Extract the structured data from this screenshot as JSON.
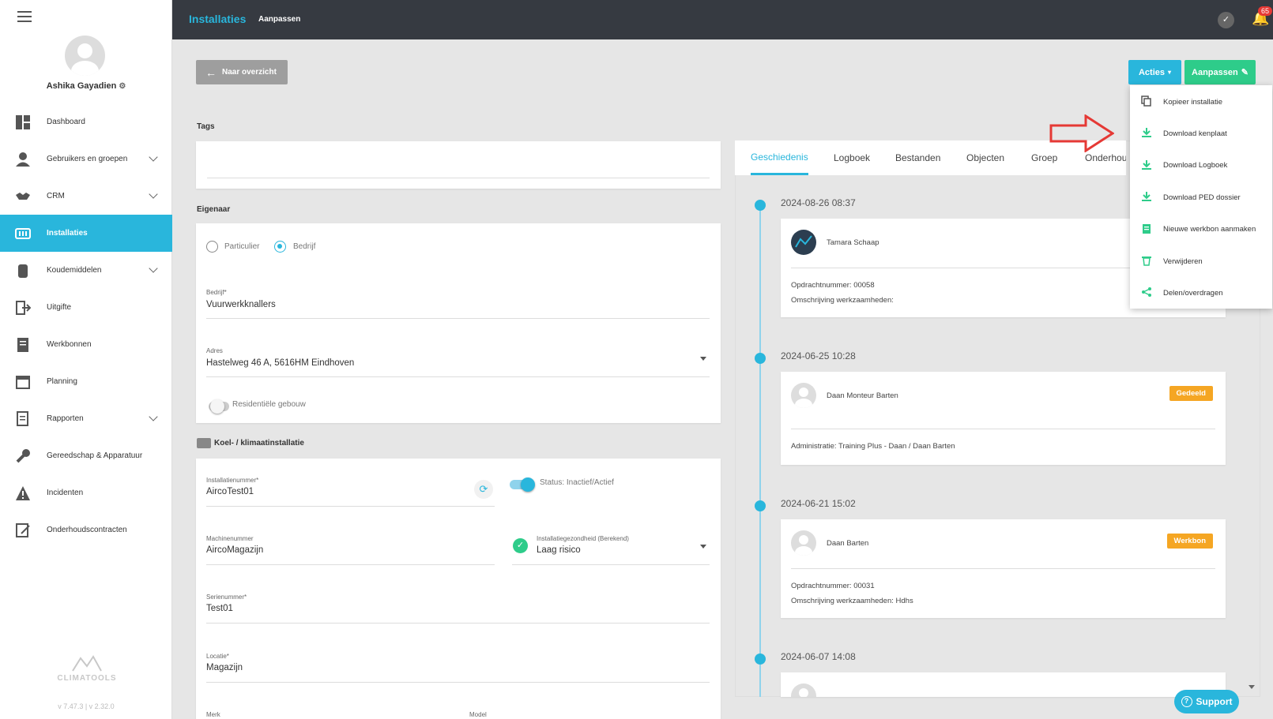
{
  "user": {
    "name": "Ashika Gayadien"
  },
  "version": "v 7.47.3 | v 2.32.0",
  "logo_text": "CLIMATOOLS",
  "sidebar": {
    "items": [
      {
        "label": "Dashboard",
        "icon": "dashboard-icon",
        "chevron": false,
        "active": false
      },
      {
        "label": "Gebruikers en groepen",
        "icon": "user-icon",
        "chevron": true,
        "active": false
      },
      {
        "label": "CRM",
        "icon": "handshake-icon",
        "chevron": true,
        "active": false
      },
      {
        "label": "Installaties",
        "icon": "installation-icon",
        "chevron": false,
        "active": true
      },
      {
        "label": "Koudemiddelen",
        "icon": "refrigerant-icon",
        "chevron": true,
        "active": false
      },
      {
        "label": "Uitgifte",
        "icon": "exit-icon",
        "chevron": false,
        "active": false
      },
      {
        "label": "Werkbonnen",
        "icon": "workorder-icon",
        "chevron": false,
        "active": false
      },
      {
        "label": "Planning",
        "icon": "calendar-icon",
        "chevron": false,
        "active": false
      },
      {
        "label": "Rapporten",
        "icon": "report-icon",
        "chevron": true,
        "active": false
      },
      {
        "label": "Gereedschap & Apparatuur",
        "icon": "wrench-icon",
        "chevron": false,
        "active": false
      },
      {
        "label": "Incidenten",
        "icon": "warning-icon",
        "chevron": false,
        "active": false
      },
      {
        "label": "Onderhoudscontracten",
        "icon": "contract-icon",
        "chevron": false,
        "active": false
      }
    ]
  },
  "header": {
    "title": "Installaties",
    "subtitle": "Aanpassen",
    "notification_count": "65"
  },
  "toolbar": {
    "back_label": "Naar overzicht",
    "acties_label": "Acties",
    "aanpassen_label": "Aanpassen"
  },
  "acties_menu": {
    "items": [
      {
        "label": "Kopieer installatie",
        "icon": "copy-icon"
      },
      {
        "label": "Download kenplaat",
        "icon": "download-icon"
      },
      {
        "label": "Download Logboek",
        "icon": "download-icon"
      },
      {
        "label": "Download PED dossier",
        "icon": "download-icon"
      },
      {
        "label": "Nieuwe werkbon aanmaken",
        "icon": "new-workorder-icon"
      },
      {
        "label": "Verwijderen",
        "icon": "trash-icon"
      },
      {
        "label": "Delen/overdragen",
        "icon": "share-icon"
      }
    ]
  },
  "form": {
    "tags_label": "Tags",
    "eigenaar_label": "Eigenaar",
    "owner_type": {
      "option1": "Particulier",
      "option2": "Bedrijf",
      "selected": "Bedrijf"
    },
    "bedrijf": {
      "label": "Bedrijf*",
      "value": "Vuurwerkknallers"
    },
    "adres": {
      "label": "Adres",
      "value": "Hastelweg 46 A, 5616HM Eindhoven"
    },
    "residentieel_label": "Residentiële gebouw",
    "koel_label": "Koel- / klimaatinstallatie",
    "installatienummer": {
      "label": "Installatienummer*",
      "value": "AircoTest01"
    },
    "status_label": "Status: Inactief/Actief",
    "machinenummer": {
      "label": "Machinenummer",
      "value": "AircoMagazijn"
    },
    "gezondheid": {
      "label": "Installatiegezondheid (Berekend)",
      "value": "Laag risico"
    },
    "serienummer": {
      "label": "Serienummer*",
      "value": "Test01"
    },
    "locatie": {
      "label": "Locatie*",
      "value": "Magazijn"
    },
    "merk_label": "Merk",
    "model_label": "Model"
  },
  "tabs": [
    "Geschiedenis",
    "Logboek",
    "Bestanden",
    "Objecten",
    "Groep",
    "Onderhou"
  ],
  "timeline": [
    {
      "date": "2024-08-26 08:37",
      "name": "Tamara Schaap",
      "badge": "",
      "lines": [
        "Opdrachtnummer: 00058",
        "Omschrijving werkzaamheden:"
      ]
    },
    {
      "date": "2024-06-25 10:28",
      "name": "Daan Monteur Barten",
      "badge": "Gedeeld",
      "lines": [
        "Administratie: Training Plus - Daan / Daan Barten"
      ]
    },
    {
      "date": "2024-06-21 15:02",
      "name": "Daan Barten",
      "badge": "Werkbon",
      "lines": [
        "Opdrachtnummer: 00031",
        "Omschrijving werkzaamheden: Hdhs"
      ]
    },
    {
      "date": "2024-06-07 14:08",
      "name": "",
      "badge": "",
      "lines": []
    }
  ],
  "support_label": "Support",
  "colors": {
    "accent": "#29b6dc",
    "green": "#2ecc8a",
    "header": "#363a41",
    "badge_orange": "#f5a623",
    "annotation_red": "#e53935"
  }
}
